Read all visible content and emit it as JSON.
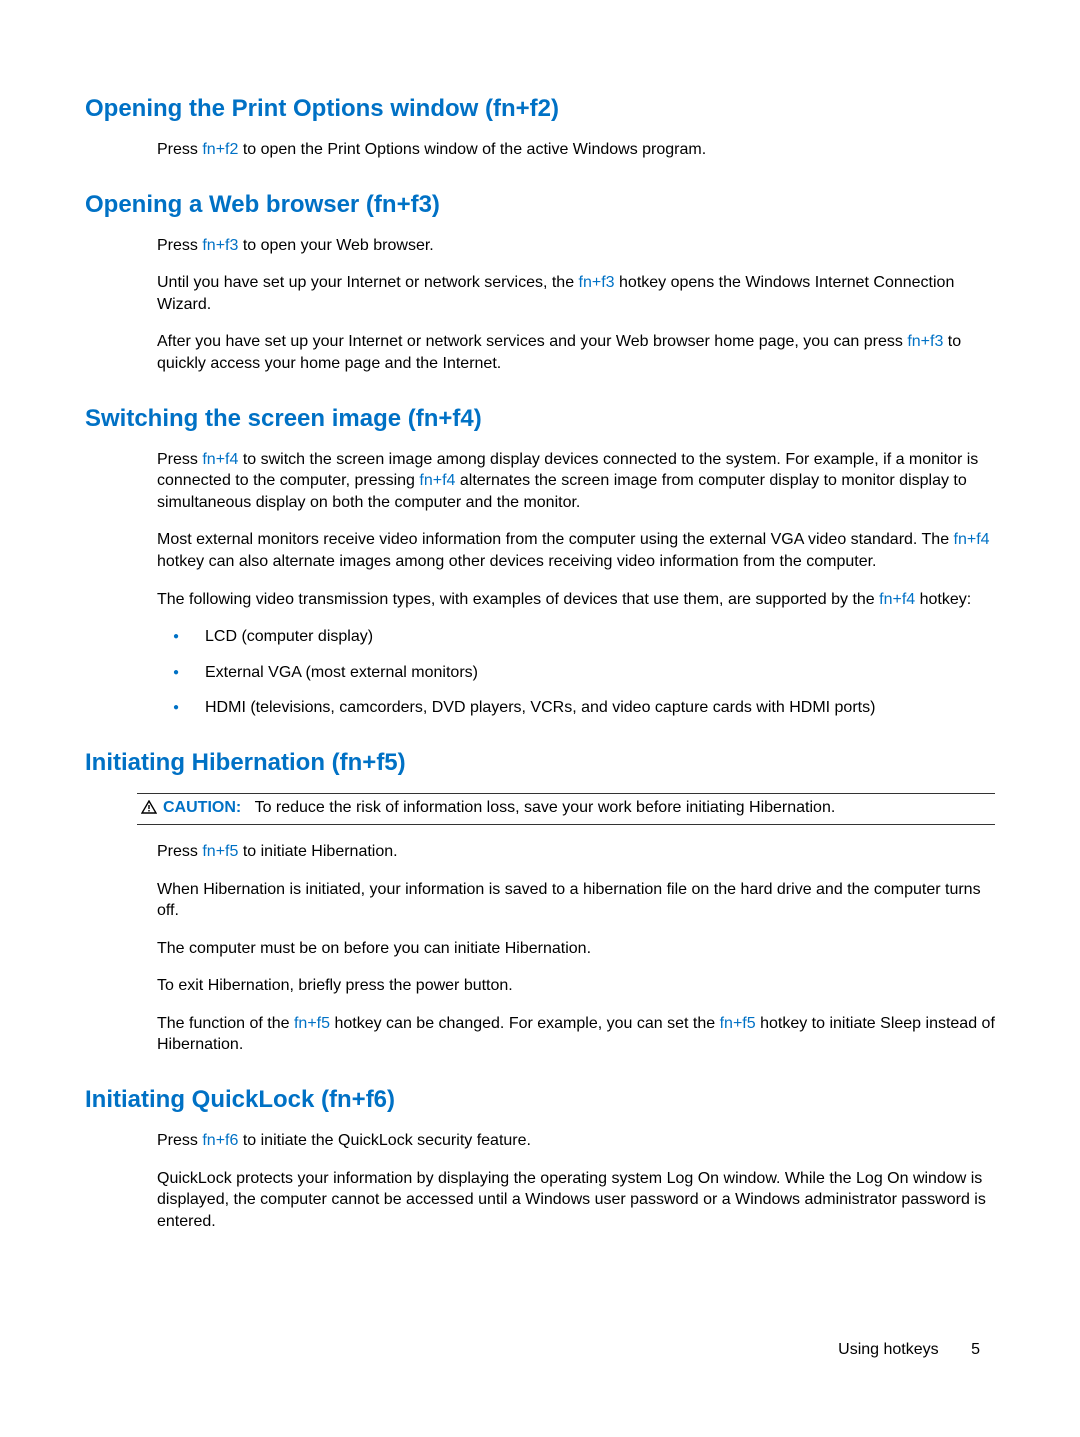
{
  "sections": {
    "s1": {
      "heading": "Opening the Print Options window (fn+f2)",
      "p1a": "Press ",
      "p1k": "fn+f2",
      "p1b": " to open the Print Options window of the active Windows program."
    },
    "s2": {
      "heading": "Opening a Web browser (fn+f3)",
      "p1a": "Press ",
      "p1k": "fn+f3",
      "p1b": " to open your Web browser.",
      "p2a": "Until you have set up your Internet or network services, the ",
      "p2k": "fn+f3",
      "p2b": " hotkey opens the Windows Internet Connection Wizard.",
      "p3a": "After you have set up your Internet or network services and your Web browser home page, you can press ",
      "p3k": "fn+f3",
      "p3b": " to quickly access your home page and the Internet."
    },
    "s3": {
      "heading": "Switching the screen image (fn+f4)",
      "p1a": "Press ",
      "p1k1": "fn+f4",
      "p1b": " to switch the screen image among display devices connected to the system. For example, if a monitor is connected to the computer, pressing ",
      "p1k2": "fn+f4",
      "p1c": " alternates the screen image from computer display to monitor display to simultaneous display on both the computer and the monitor.",
      "p2a": "Most external monitors receive video information from the computer using the external VGA video standard. The ",
      "p2k": "fn+f4",
      "p2b": " hotkey can also alternate images among other devices receiving video information from the computer.",
      "p3a": "The following video transmission types, with examples of devices that use them, are supported by the ",
      "p3k": "fn+f4",
      "p3b": " hotkey:",
      "li1": "LCD (computer display)",
      "li2": "External VGA (most external monitors)",
      "li3": "HDMI (televisions, camcorders, DVD players, VCRs, and video capture cards with HDMI ports)"
    },
    "s4": {
      "heading": "Initiating Hibernation (fn+f5)",
      "caution_label": "CAUTION:",
      "caution_text": "To reduce the risk of information loss, save your work before initiating Hibernation.",
      "p1a": "Press ",
      "p1k": "fn+f5",
      "p1b": " to initiate Hibernation.",
      "p2": "When Hibernation is initiated, your information is saved to a hibernation file on the hard drive and the computer turns off.",
      "p3": "The computer must be on before you can initiate Hibernation.",
      "p4": "To exit Hibernation, briefly press the power button.",
      "p5a": "The function of the ",
      "p5k1": "fn+f5",
      "p5b": " hotkey can be changed. For example, you can set the ",
      "p5k2": "fn+f5",
      "p5c": " hotkey to initiate Sleep instead of Hibernation."
    },
    "s5": {
      "heading": "Initiating QuickLock (fn+f6)",
      "p1a": "Press ",
      "p1k": "fn+f6",
      "p1b": " to initiate the QuickLock security feature.",
      "p2": "QuickLock protects your information by displaying the operating system Log On window. While the Log On window is displayed, the computer cannot be accessed until a Windows user password or a Windows administrator password is entered."
    }
  },
  "footer": {
    "label": "Using hotkeys",
    "page": "5"
  }
}
